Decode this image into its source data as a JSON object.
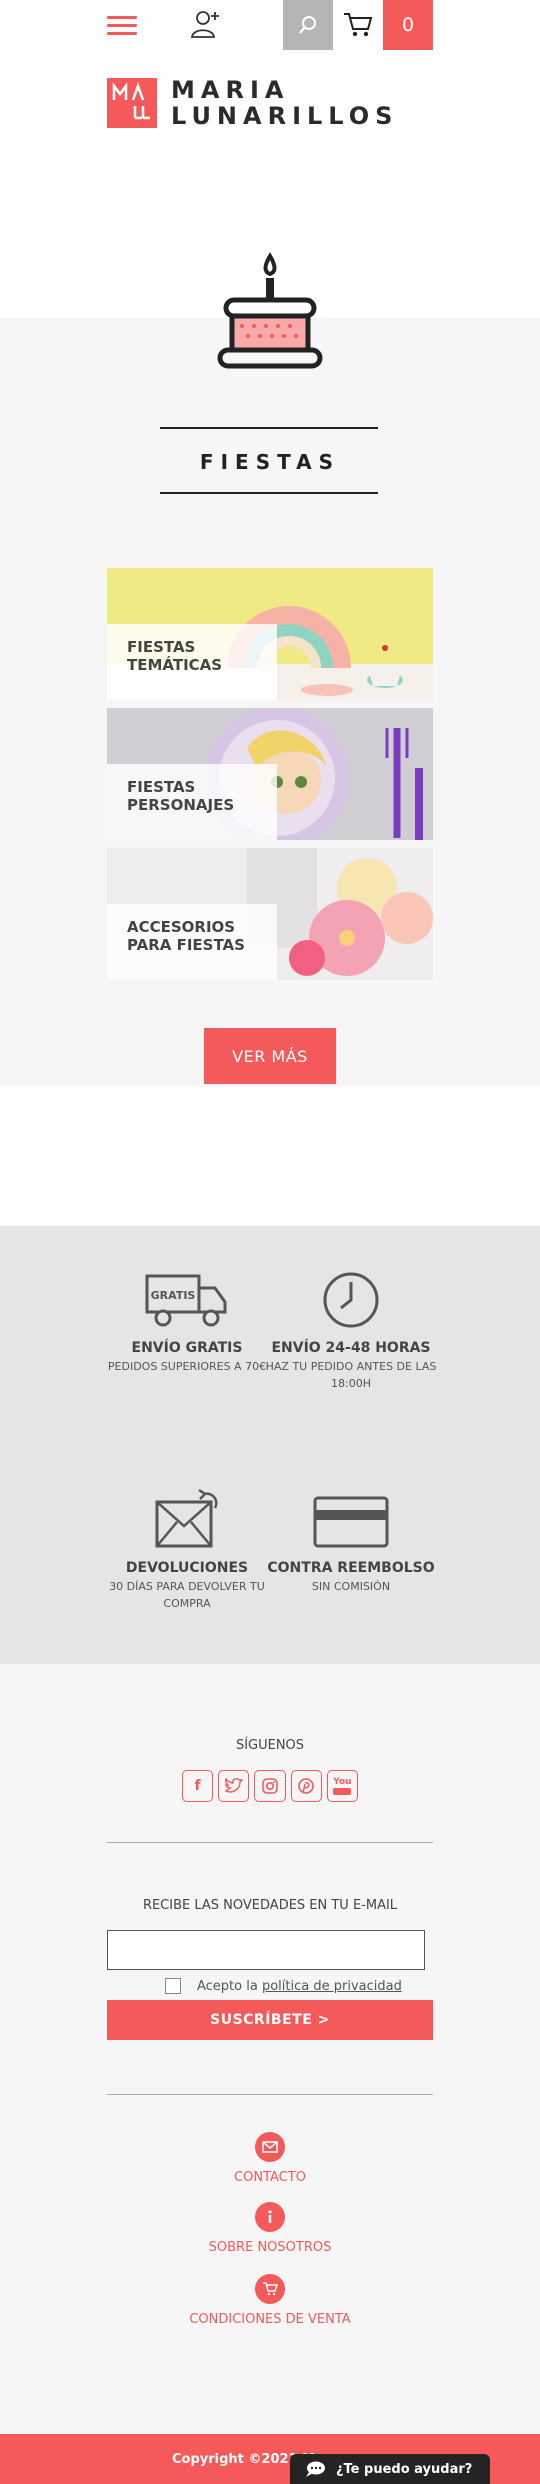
{
  "header": {
    "menu_icon": "hamburger-icon",
    "user_icon": "user-add-icon",
    "search_icon": "search-icon",
    "cart_icon": "cart-icon",
    "cart_count": "0"
  },
  "logo": {
    "line1": "MARIA",
    "line2": "LUNARILLOS",
    "mark": "ML"
  },
  "fiestas": {
    "title": "FIESTAS",
    "categories": [
      {
        "line1": "FIESTAS",
        "line2": "TEMÁTICAS"
      },
      {
        "line1": "FIESTAS",
        "line2": "PERSONAJES"
      },
      {
        "line1": "ACCESORIOS",
        "line2": "PARA FIESTAS"
      }
    ],
    "ver_mas": "VER MÁS"
  },
  "features": [
    {
      "title": "ENVÍO GRATIS",
      "sub": "PEDIDOS SUPERIORES A 70€",
      "icon": "truck-icon",
      "icon_text": "GRATIS"
    },
    {
      "title": "ENVÍO 24-48 HORAS",
      "sub": "HAZ TU PEDIDO ANTES DE LAS 18:00H",
      "icon": "clock-icon"
    },
    {
      "title": "DEVOLUCIONES",
      "sub": "30 DÍAS PARA DEVOLVER TU COMPRA",
      "icon": "return-envelope-icon"
    },
    {
      "title": "CONTRA REEMBOLSO",
      "sub": "SIN COMISIÓN",
      "icon": "credit-card-icon"
    }
  ],
  "social": {
    "title": "SÍGUENOS",
    "items": [
      {
        "name": "facebook",
        "glyph": "f"
      },
      {
        "name": "twitter",
        "glyph": "t"
      },
      {
        "name": "instagram",
        "glyph": "◎"
      },
      {
        "name": "pinterest",
        "glyph": "p"
      },
      {
        "name": "youtube",
        "glyph": "You"
      }
    ]
  },
  "newsletter": {
    "title": "RECIBE LAS NOVEDADES EN TU E-MAIL",
    "email_value": "",
    "privacy_prefix": "Acepto la ",
    "privacy_link": "política de privacidad",
    "subscribe": "SUSCRÍBETE >"
  },
  "footer_links": [
    {
      "label": "CONTACTO",
      "icon": "mail-icon"
    },
    {
      "label": "SOBRE NOSOTROS",
      "icon": "info-icon"
    },
    {
      "label": "CONDICIONES DE VENTA",
      "icon": "cart-icon"
    }
  ],
  "bottom": {
    "copyright": "Copyright ©2021 Ma",
    "chat": "¿Te puedo ayudar?"
  },
  "colors": {
    "accent": "#f45a5a",
    "gray_band": "#e6e5e3",
    "light_bg": "#f6f6f6"
  }
}
